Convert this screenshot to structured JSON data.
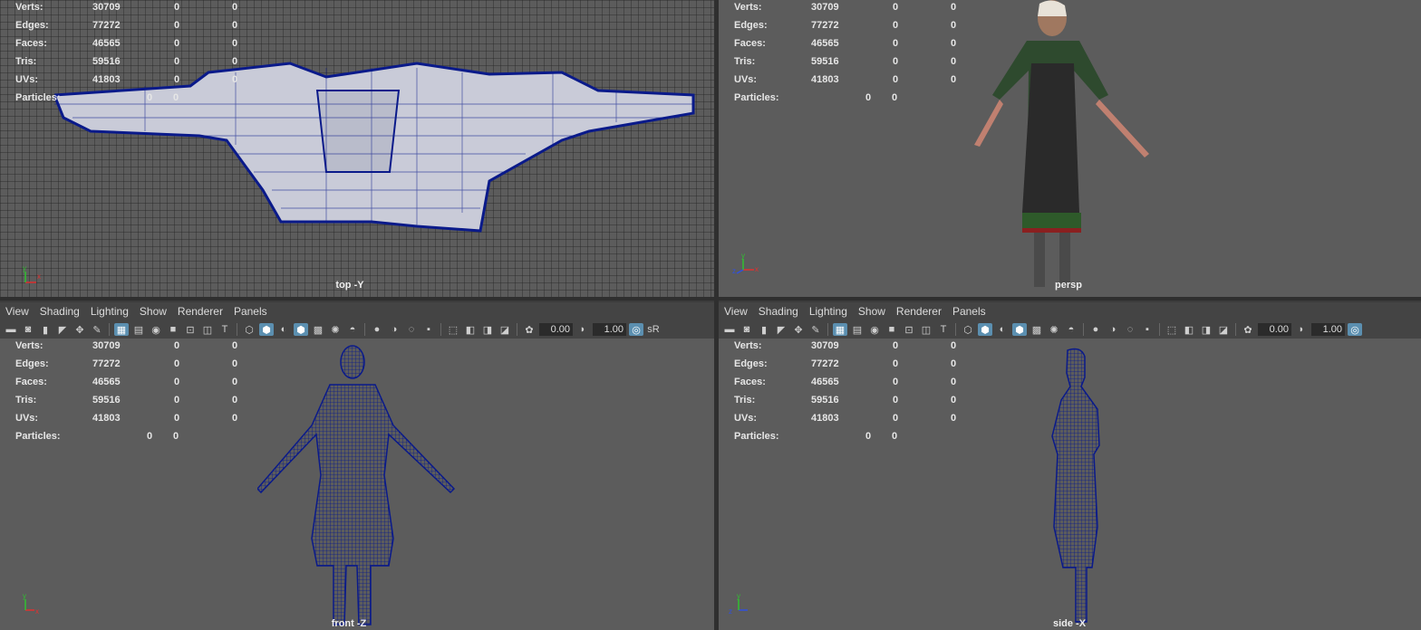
{
  "menu": [
    "View",
    "Shading",
    "Lighting",
    "Show",
    "Renderer",
    "Panels"
  ],
  "toolbar": {
    "field1": "0.00",
    "field2": "1.00",
    "trunc": "sR"
  },
  "hud": {
    "labels": {
      "verts": "Verts:",
      "edges": "Edges:",
      "faces": "Faces:",
      "tris": "Tris:",
      "uvs": "UVs:",
      "particles": "Particles:"
    },
    "verts": [
      "30709",
      "0",
      "0"
    ],
    "edges": [
      "77272",
      "0",
      "0"
    ],
    "faces": [
      "46565",
      "0",
      "0"
    ],
    "tris": [
      "59516",
      "0",
      "0"
    ],
    "uvs": [
      "41803",
      "0",
      "0"
    ],
    "particles": [
      "0",
      "0"
    ]
  },
  "cameras": {
    "top": "top -Y",
    "persp": "persp",
    "front": "front -Z",
    "side": "side -X"
  },
  "axis": {
    "x": "x",
    "y": "y",
    "z": "z"
  },
  "colors": {
    "viewport_bg": "#5c5c5c",
    "wire": "#0a1a8a",
    "panel": "#444444"
  }
}
